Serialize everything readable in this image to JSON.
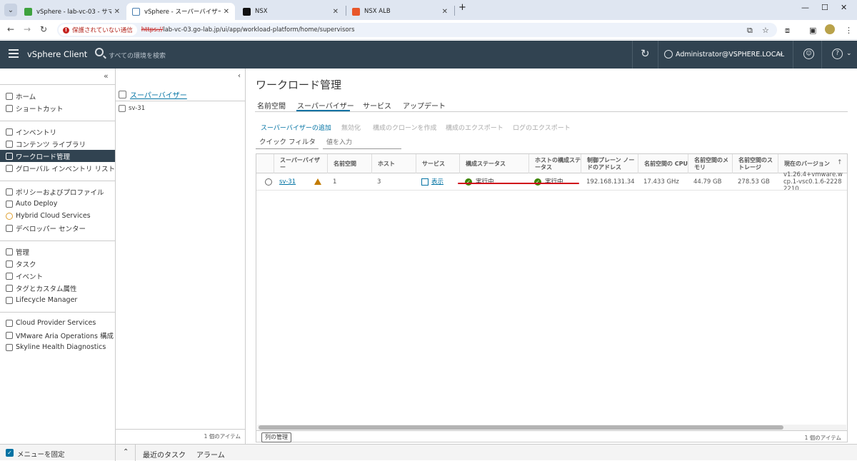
{
  "browser": {
    "tabs": [
      {
        "title": "vSphere - lab-vc-03 - サマリ",
        "favicon_color": "#3ea23e"
      },
      {
        "title": "vSphere - スーパーバイザー",
        "favicon_color": "#4a7fb0"
      },
      {
        "title": "NSX",
        "favicon_color": "#111111"
      },
      {
        "title": "NSX ALB",
        "favicon_color": "#e8562a"
      }
    ],
    "new_tab": "+",
    "insecure_label": "保護されていない通信",
    "url_scheme": "https://",
    "url_rest": "lab-vc-03.go-lab.jp/ui/app/workload-platform/home/supervisors"
  },
  "header": {
    "app_title": "vSphere Client",
    "search_placeholder": "すべての環境を検索",
    "user": "Administrator@VSPHERE.LOCAL"
  },
  "nav": {
    "collapse": "«",
    "groups": [
      [
        {
          "label": "ホーム",
          "icon": "home-icon"
        },
        {
          "label": "ショートカット",
          "icon": "shortcut-icon"
        }
      ],
      [
        {
          "label": "インベントリ",
          "icon": "inventory-icon"
        },
        {
          "label": "コンテンツ ライブラリ",
          "icon": "library-icon"
        },
        {
          "label": "ワークロード管理",
          "icon": "workload-icon",
          "selected": true
        },
        {
          "label": "グローバル インベントリ リスト",
          "icon": "list-icon"
        }
      ],
      [
        {
          "label": "ポリシーおよびプロファイル",
          "icon": "policy-icon"
        },
        {
          "label": "Auto Deploy",
          "icon": "deploy-icon"
        },
        {
          "label": "Hybrid Cloud Services",
          "icon": "cloud-icon"
        },
        {
          "label": "デベロッパー センター",
          "icon": "code-icon"
        }
      ],
      [
        {
          "label": "管理",
          "icon": "admin-icon"
        },
        {
          "label": "タスク",
          "icon": "task-icon"
        },
        {
          "label": "イベント",
          "icon": "event-icon"
        },
        {
          "label": "タグとカスタム属性",
          "icon": "tag-icon"
        },
        {
          "label": "Lifecycle Manager",
          "icon": "lifecycle-icon"
        }
      ],
      [
        {
          "label": "Cloud Provider Services",
          "icon": "cloud-provider-icon"
        },
        {
          "label": "VMware Aria Operations 構成",
          "icon": "aria-icon"
        },
        {
          "label": "Skyline Health Diagnostics",
          "icon": "skyline-icon"
        }
      ]
    ]
  },
  "tree": {
    "header": "スーパーバイザー",
    "items": [
      "sv-31"
    ],
    "count": "1 個のアイテム"
  },
  "main": {
    "title": "ワークロード管理",
    "tabs": [
      "名前空間",
      "スーパーバイザー",
      "サービス",
      "アップデート"
    ],
    "active_tab": 1,
    "actions": [
      {
        "label": "スーパーバイザーの追加",
        "enabled": true
      },
      {
        "label": "無効化",
        "enabled": false
      },
      {
        "label": "構成のクローンを作成",
        "enabled": false
      },
      {
        "label": "構成のエクスポート",
        "enabled": false
      },
      {
        "label": "ログのエクスポート",
        "enabled": false
      }
    ],
    "quick_filter": "クイック フィルタ",
    "filter_placeholder": "値を入力"
  },
  "grid": {
    "columns": [
      "スーパーバイザー",
      "名前空間",
      "ホスト",
      "サービス",
      "構成ステータス",
      "ホストの構成ステータス",
      "制御プレーン ノードのアドレス",
      "名前空間の CPU",
      "名前空間のメモリ",
      "名前空間のストレージ",
      "現在のバージョン"
    ],
    "rows": [
      {
        "supervisor": "sv-31",
        "namespaces": "1",
        "hosts": "3",
        "services": "表示",
        "config_status": "実行中",
        "host_config_status": "実行中",
        "control_plane": "192.168.131.34",
        "cpu": "17.433 GHz",
        "memory": "44.79 GB",
        "storage": "278.53 GB",
        "version": "v1.26.4+vmware.wcp.1-vsc0.1.6-22282210"
      }
    ],
    "manage_columns": "列の管理",
    "count": "1 個のアイテム"
  },
  "bottom": {
    "pin_label": "メニューを固定",
    "recent_tasks": "最近のタスク",
    "alarms": "アラーム"
  },
  "colors": {
    "header_bg": "#314351",
    "accent": "#0072a3",
    "ok": "#3c8500",
    "warning": "#c27b00",
    "annotation": "#d0021b"
  }
}
